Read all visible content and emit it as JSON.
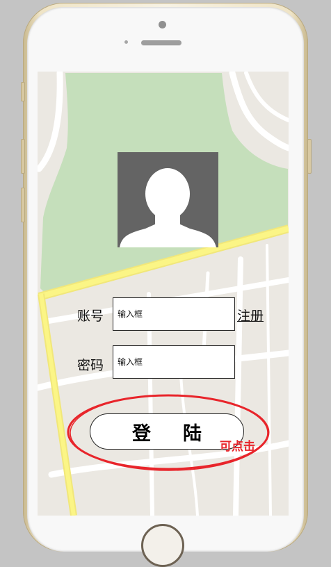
{
  "form": {
    "account_label": "账号",
    "account_placeholder": "输入框",
    "register_label": "注册",
    "password_label": "密码",
    "password_placeholder": "输入框",
    "login_label_chars": [
      "登",
      "陆"
    ]
  },
  "annotation": {
    "clickable_note": "可点击",
    "color": "#e8252b"
  },
  "colors": {
    "map_park": "#c5dfbb",
    "map_land": "#ebe8e2",
    "map_road_major": "#fbf586",
    "map_road_minor": "#ffffff",
    "avatar_bg": "#646464"
  }
}
